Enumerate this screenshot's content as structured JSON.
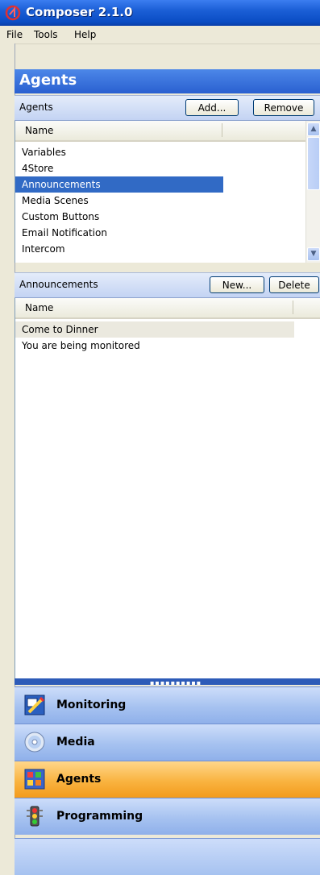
{
  "window": {
    "title": "Composer 2.1.0"
  },
  "menu": {
    "items": [
      "File",
      "Tools",
      "Help"
    ]
  },
  "pane": {
    "title": "Agents"
  },
  "agents_group": {
    "label": "Agents",
    "add_label": "Add...",
    "remove_label": "Remove",
    "column_header": "Name",
    "items": [
      "Variables",
      "4Store",
      "Announcements",
      "Media Scenes",
      "Custom Buttons",
      "Email Notification",
      "Intercom"
    ],
    "selected": "Announcements"
  },
  "announcements_group": {
    "label": "Announcements",
    "new_label": "New...",
    "delete_label": "Delete",
    "column_header": "Name",
    "items": [
      "Come to Dinner",
      "You are being monitored"
    ]
  },
  "nav": {
    "items": [
      {
        "label": "Monitoring",
        "icon": "monitoring-icon"
      },
      {
        "label": "Media",
        "icon": "media-disc-icon"
      },
      {
        "label": "Agents",
        "icon": "agents-icon",
        "active": true
      },
      {
        "label": "Programming",
        "icon": "traffic-light-icon"
      }
    ]
  },
  "colors": {
    "titlebar": "#0a4cc4",
    "selection": "#316ac5",
    "active_nav": "#f9b340",
    "nav_bar": "#a6c2f0"
  }
}
